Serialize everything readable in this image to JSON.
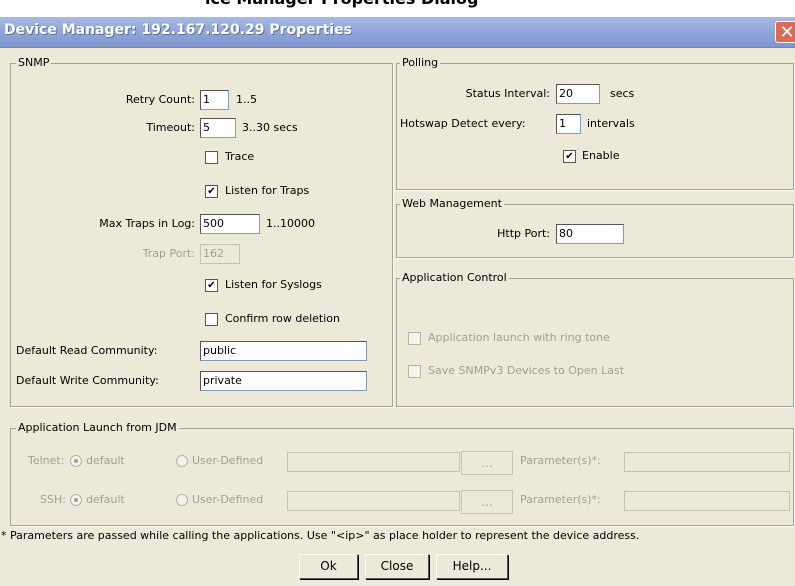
{
  "header_fragment": "ice Manager Properties Dialog",
  "window": {
    "title": "Device Manager: 192.167.120.29 Properties",
    "close_glyph": "✕"
  },
  "snmp": {
    "legend": "SNMP",
    "retry_count": {
      "label": "Retry Count:",
      "value": "1",
      "hint": "1..5"
    },
    "timeout": {
      "label": "Timeout:",
      "value": "5",
      "hint": "3..30 secs"
    },
    "trace": {
      "label": "Trace",
      "checked": false
    },
    "listen_traps": {
      "label": "Listen for Traps",
      "checked": true
    },
    "max_traps": {
      "label": "Max Traps in Log:",
      "value": "500",
      "hint": "1..10000"
    },
    "trap_port": {
      "label": "Trap Port:",
      "value": "162"
    },
    "listen_syslogs": {
      "label": "Listen for Syslogs",
      "checked": true
    },
    "confirm_delete": {
      "label": "Confirm row deletion",
      "checked": false
    },
    "read_community": {
      "label": "Default Read Community:",
      "value": "public"
    },
    "write_community": {
      "label": "Default Write Community:",
      "value": "private"
    }
  },
  "polling": {
    "legend": "Polling",
    "status_interval": {
      "label": "Status Interval:",
      "value": "20",
      "unit": "secs"
    },
    "hotswap": {
      "label": "Hotswap Detect every:",
      "value": "1",
      "unit": "intervals"
    },
    "enable": {
      "label": "Enable",
      "checked": true
    }
  },
  "web": {
    "legend": "Web Management",
    "http_port": {
      "label": "Http Port:",
      "value": "80"
    }
  },
  "appctl": {
    "legend": "Application Control",
    "ring_tone": {
      "label": "Application launch with ring tone",
      "checked": false
    },
    "snmpv3_last": {
      "label": "Save SNMPv3 Devices to Open Last",
      "checked": false
    }
  },
  "launch": {
    "legend": "Application Launch from JDM",
    "telnet": {
      "label": "Telnet:",
      "default_label": "default",
      "user_label": "User-Defined",
      "browse": "...",
      "params_label": "Parameter(s)*:"
    },
    "ssh": {
      "label": "SSH:",
      "default_label": "default",
      "user_label": "User-Defined",
      "browse": "...",
      "params_label": "Parameter(s)*:"
    }
  },
  "footnote": "* Parameters are passed while calling the applications. Use \"<ip>\" as place holder to represent the device address.",
  "buttons": {
    "ok": "Ok",
    "close": "Close",
    "help": "Help..."
  },
  "check_glyph": "✔"
}
